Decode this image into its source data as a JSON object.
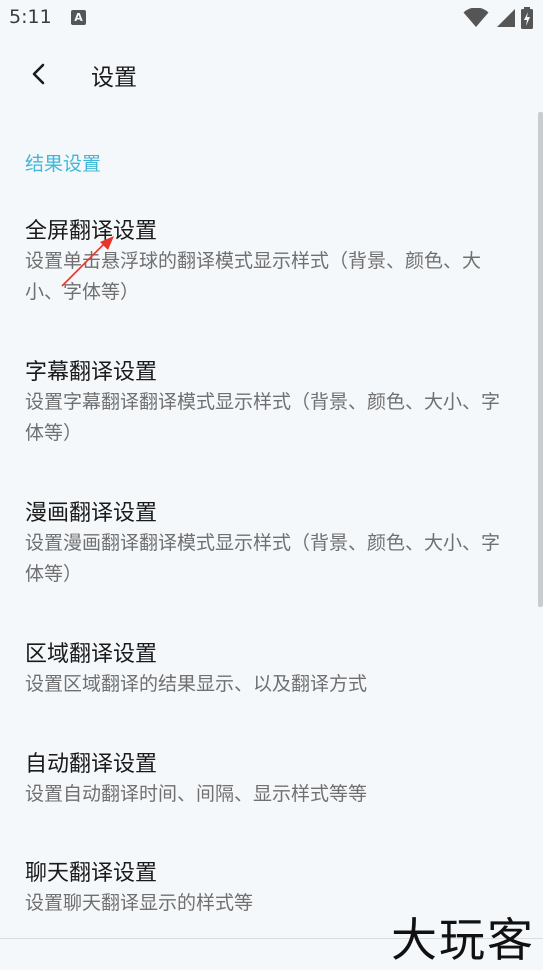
{
  "status_bar": {
    "time": "5:11",
    "notification_icon": "A",
    "icons": [
      "wifi-icon",
      "signal-icon",
      "battery-charging-icon"
    ]
  },
  "app_bar": {
    "back_icon": "chevron-left-icon",
    "title": "设置"
  },
  "section": {
    "title": "结果设置",
    "color": "#3fb8d8"
  },
  "items": [
    {
      "title": "全屏翻译设置",
      "desc": "设置单击悬浮球的翻译模式显示样式（背景、颜色、大小、字体等）"
    },
    {
      "title": "字幕翻译设置",
      "desc": "设置字幕翻译翻译模式显示样式（背景、颜色、大小、字体等）"
    },
    {
      "title": "漫画翻译设置",
      "desc": "设置漫画翻译翻译模式显示样式（背景、颜色、大小、字体等）"
    },
    {
      "title": "区域翻译设置",
      "desc": "设置区域翻译的结果显示、以及翻译方式"
    },
    {
      "title": "自动翻译设置",
      "desc": "设置自动翻译时间、间隔、显示样式等等"
    },
    {
      "title": "聊天翻译设置",
      "desc": "设置聊天翻译显示的样式等"
    }
  ],
  "watermark": "大玩客",
  "annotation": {
    "color": "#e8352b"
  }
}
